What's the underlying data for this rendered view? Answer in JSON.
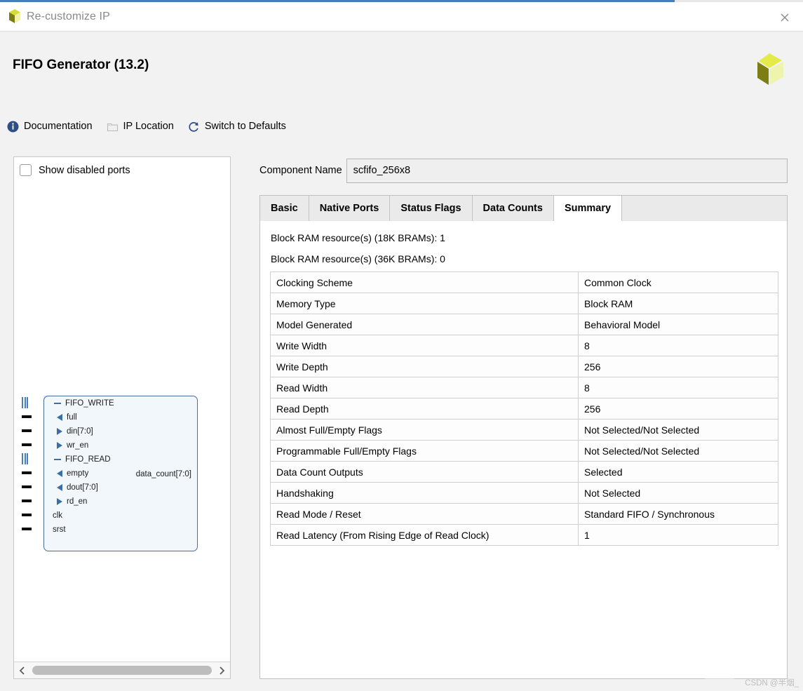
{
  "window": {
    "title": "Re-customize IP",
    "logo_icon": "xilinx-logo-icon",
    "close_icon": "close-icon",
    "accent_color": "#4a7ebb"
  },
  "header": {
    "page_title": "FIFO Generator (13.2)",
    "brand_logo_icon": "xilinx-logo-icon"
  },
  "toolbar": {
    "items": [
      {
        "label": "Documentation",
        "icon": "info-icon"
      },
      {
        "label": "IP Location",
        "icon": "folder-icon"
      },
      {
        "label": "Switch to Defaults",
        "icon": "refresh-icon"
      }
    ]
  },
  "left_panel": {
    "show_disabled_ports": {
      "label": "Show disabled ports",
      "checked": false
    },
    "scrollbar": {
      "left_arrow_icon": "chevron-left-icon",
      "right_arrow_icon": "chevron-right-icon"
    },
    "symbol": {
      "left_ports": [
        {
          "label": "FIFO_WRITE",
          "marker": "group-dash",
          "stub": "bus"
        },
        {
          "label": "full",
          "marker": "arrow-out",
          "stub": "wire"
        },
        {
          "label": "din[7:0]",
          "marker": "arrow-in",
          "stub": "wire"
        },
        {
          "label": "wr_en",
          "marker": "arrow-in",
          "stub": "wire"
        },
        {
          "label": "FIFO_READ",
          "marker": "group-dash",
          "stub": "bus"
        },
        {
          "label": "empty",
          "marker": "arrow-out",
          "stub": "wire"
        },
        {
          "label": "dout[7:0]",
          "marker": "arrow-out",
          "stub": "wire"
        },
        {
          "label": "rd_en",
          "marker": "arrow-in",
          "stub": "wire"
        },
        {
          "label": "clk",
          "marker": "none",
          "stub": "wire"
        },
        {
          "label": "srst",
          "marker": "none",
          "stub": "wire"
        }
      ],
      "right_ports": [
        {
          "label": "data_count[7:0]",
          "stub": "wire"
        }
      ]
    }
  },
  "right_panel": {
    "component_name": {
      "label": "Component Name",
      "value": "scfifo_256x8",
      "placeholder": "Component Name"
    },
    "tabs": [
      {
        "label": "Basic",
        "active": false
      },
      {
        "label": "Native Ports",
        "active": false
      },
      {
        "label": "Status Flags",
        "active": false
      },
      {
        "label": "Data Counts",
        "active": false
      },
      {
        "label": "Summary",
        "active": true
      }
    ],
    "summary": {
      "bram_18k": "Block RAM resource(s) (18K BRAMs): 1",
      "bram_36k": "Block RAM resource(s) (36K BRAMs): 0",
      "rows": [
        {
          "key": "Clocking Scheme",
          "value": "Common Clock"
        },
        {
          "key": "Memory Type",
          "value": "Block RAM"
        },
        {
          "key": "Model Generated",
          "value": "Behavioral Model"
        },
        {
          "key": "Write Width",
          "value": "8"
        },
        {
          "key": "Write Depth",
          "value": "256"
        },
        {
          "key": "Read Width",
          "value": "8"
        },
        {
          "key": "Read Depth",
          "value": "256"
        },
        {
          "key": "Almost Full/Empty Flags",
          "value": "Not Selected/Not Selected"
        },
        {
          "key": "Programmable Full/Empty Flags",
          "value": "Not Selected/Not Selected"
        },
        {
          "key": "Data Count Outputs",
          "value": "Selected"
        },
        {
          "key": "Handshaking",
          "value": "Not Selected"
        },
        {
          "key": "Read Mode / Reset",
          "value": "Standard FIFO / Synchronous"
        },
        {
          "key": "Read Latency (From Rising Edge of Read Clock)",
          "value": "1"
        }
      ]
    }
  },
  "watermark": {
    "text": "CSDN @半烟_"
  }
}
